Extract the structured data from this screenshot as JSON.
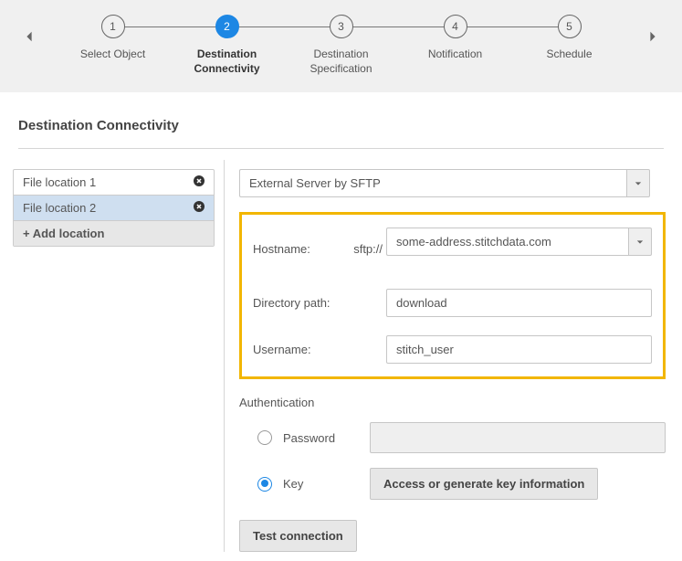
{
  "stepper": {
    "steps": [
      {
        "num": "1",
        "label": "Select Object"
      },
      {
        "num": "2",
        "label": "Destination Connectivity"
      },
      {
        "num": "3",
        "label": "Destination Specification"
      },
      {
        "num": "4",
        "label": "Notification"
      },
      {
        "num": "5",
        "label": "Schedule"
      }
    ],
    "active_index": 1
  },
  "section_title": "Destination Connectivity",
  "locations": {
    "items": [
      {
        "label": "File location 1"
      },
      {
        "label": "File location 2"
      }
    ],
    "add_label": "+ Add location",
    "selected_index": 1
  },
  "server_type": "External Server by SFTP",
  "hostname": {
    "label": "Hostname:",
    "prefix": "sftp://",
    "value": "some-address.stitchdata.com"
  },
  "directory": {
    "label": "Directory path:",
    "value": "download"
  },
  "username": {
    "label": "Username:",
    "value": "stitch_user"
  },
  "auth": {
    "title": "Authentication",
    "password_label": "Password",
    "key_label": "Key",
    "key_button": "Access or generate key information",
    "selected": "key"
  },
  "test_button": "Test connection"
}
